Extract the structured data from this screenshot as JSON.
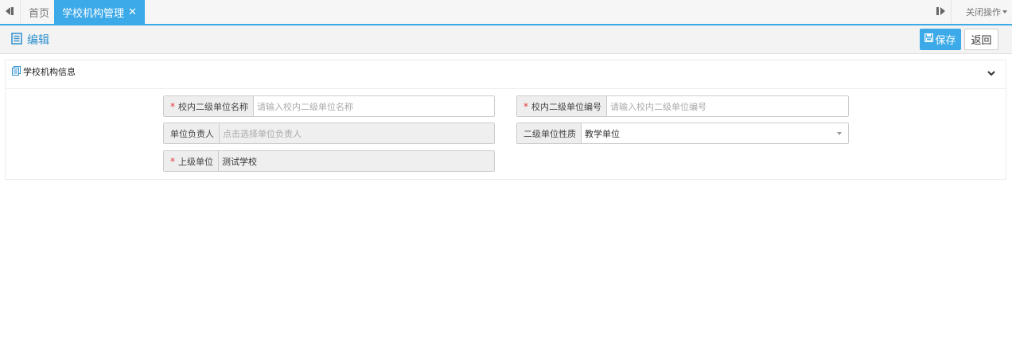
{
  "tabbar": {
    "home_label": "首页",
    "active_tab_label": "学校机构管理",
    "close_symbol": "✕",
    "ops_label": "关闭操作"
  },
  "edit_bar": {
    "title": "编辑",
    "save_label": "保存",
    "back_label": "返回"
  },
  "panel": {
    "title": "学校机构信息",
    "fields": {
      "unit_name": {
        "label": "校内二级单位名称",
        "required": true,
        "placeholder": "请输入校内二级单位名称",
        "value": ""
      },
      "unit_code": {
        "label": "校内二级单位编号",
        "required": true,
        "placeholder": "请输入校内二级单位编号",
        "value": ""
      },
      "unit_leader": {
        "label": "单位负责人",
        "required": false,
        "placeholder": "点击选择单位负责人",
        "value": ""
      },
      "unit_nature": {
        "label": "二级单位性质",
        "required": false,
        "value": "教学单位"
      },
      "parent_unit": {
        "label": "上级单位",
        "required": true,
        "value": "测试学校"
      }
    },
    "required_mark": "*"
  },
  "colors": {
    "accent": "#3ca9e8",
    "title_blue": "#2c8fce",
    "required_red": "#e43b3b"
  }
}
